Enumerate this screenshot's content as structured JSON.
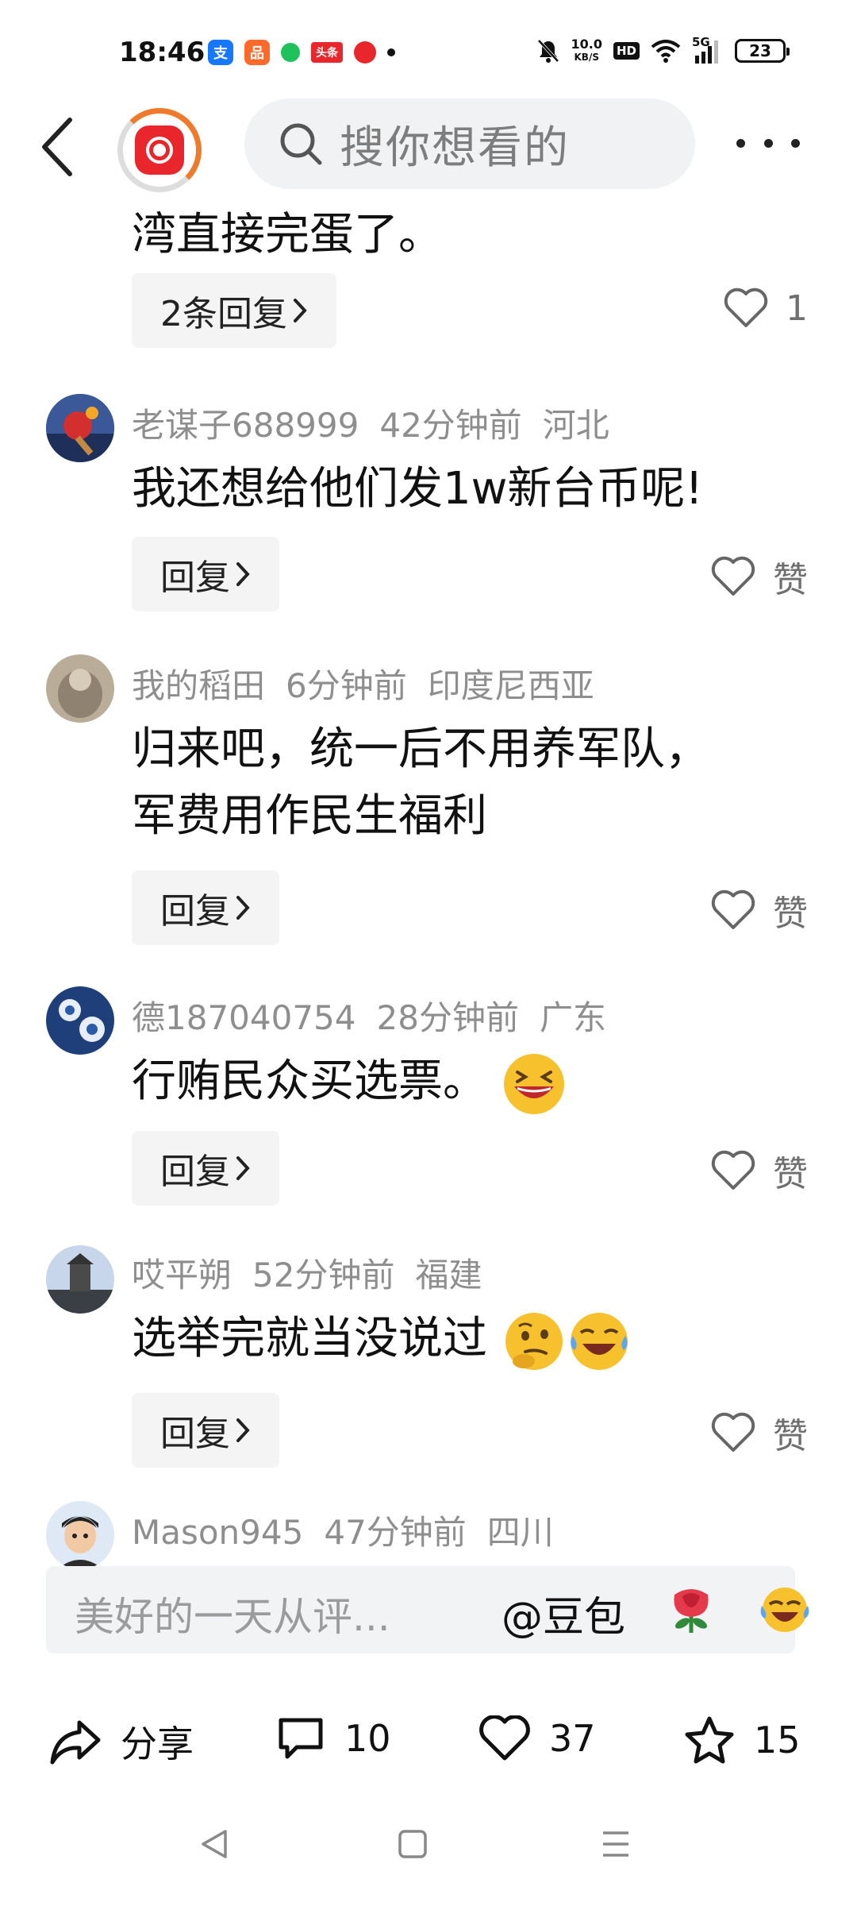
{
  "status_bar": {
    "time": "18:46",
    "net_speed_value": "10.0",
    "net_speed_unit": "KB/S",
    "hd": "HD",
    "signal": "5G",
    "battery": "23"
  },
  "search": {
    "placeholder": "搜你想看的"
  },
  "top_comment": {
    "text_tail": "湾直接完蛋了。",
    "replies_label": "2条回复",
    "like_count": "1"
  },
  "comments": [
    {
      "user": "老谋子688999",
      "time": "42分钟前",
      "location": "河北",
      "text": "我还想给他们发1w新台币呢!",
      "reply_label": "回复",
      "like_label": "赞"
    },
    {
      "user": "我的稻田",
      "time": "6分钟前",
      "location": "印度尼西亚",
      "text_line1": "归来吧，统一后不用养军队，",
      "text_line2": "军费用作民生福利",
      "reply_label": "回复",
      "like_label": "赞"
    },
    {
      "user": "德187040754",
      "time": "28分钟前",
      "location": "广东",
      "text": "行贿民众买选票。",
      "reply_label": "回复",
      "like_label": "赞"
    },
    {
      "user": "哎平朔",
      "time": "52分钟前",
      "location": "福建",
      "text": "选举完就当没说过",
      "reply_label": "回复",
      "like_label": "赞"
    },
    {
      "user": "Mason945",
      "time": "47分钟前",
      "location": "四川"
    }
  ],
  "input_bar": {
    "placeholder": "美好的一天从评...",
    "mention": "@豆包"
  },
  "actions": {
    "share_label": "分享",
    "comment_count": "10",
    "like_count": "37",
    "favorite_count": "15"
  },
  "icons": [
    "back-icon",
    "search-icon",
    "more-icon",
    "chevron-right-icon",
    "heart-icon",
    "share-icon",
    "comment-icon",
    "star-icon",
    "rose-icon",
    "laughing-icon",
    "back-nav-icon",
    "home-nav-icon",
    "menu-nav-icon"
  ],
  "colors": {
    "accent_orange": "#f07a2b",
    "logo_red": "#e8262b",
    "meta_gray": "#8e8e8e",
    "pill_bg": "#f4f4f5"
  }
}
